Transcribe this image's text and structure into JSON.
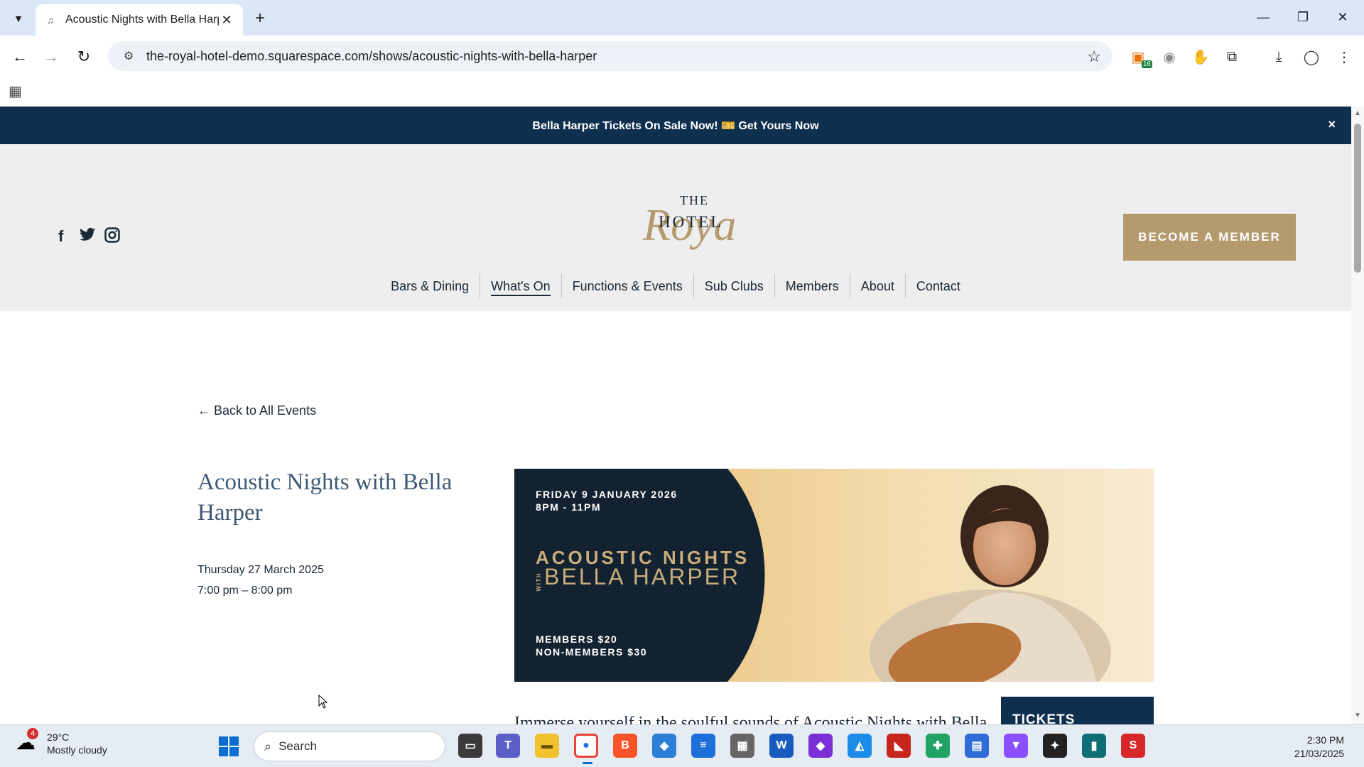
{
  "browser": {
    "tab_title": "Acoustic Nights with Bella Harp",
    "url": "the-royal-hotel-demo.squarespace.com/shows/acoustic-nights-with-bella-harper",
    "extension_badge": "16"
  },
  "announcement": {
    "text": "Bella Harper Tickets On Sale Now! 🎫 Get Yours Now",
    "close": "×"
  },
  "header": {
    "logo": {
      "the": "THE",
      "royal": "Royal",
      "hotel": "HOTEL"
    },
    "cta": "BECOME A MEMBER",
    "nav": [
      "Bars & Dining",
      "What's On",
      "Functions & Events",
      "Sub Clubs",
      "Members",
      "About",
      "Contact"
    ]
  },
  "event": {
    "back_link": "← Back to All Events",
    "title": "Acoustic Nights with Bella Harper",
    "date": "Thursday 27 March 2025",
    "time": "7:00 pm – 8:00 pm",
    "poster": {
      "date_line": "FRIDAY 9 JANUARY 2026",
      "time_line": "8PM - 11PM",
      "title_line": "ACOUSTIC NIGHTS",
      "with": "WITH",
      "artist": "BELLA HARPER",
      "members_price": "MEMBERS $20",
      "non_members_price": "NON-MEMBERS $30"
    },
    "description_start": "Immerse yourself in the soulful sounds of Acoustic Nights with Bella",
    "tickets_heading": "TICKETS"
  },
  "taskbar": {
    "weather_temp": "29°C",
    "weather_desc": "Mostly cloudy",
    "weather_badge": "4",
    "search_placeholder": "Search",
    "time": "2:30 PM",
    "date": "21/03/2025"
  },
  "colors": {
    "navy": "#0f2f4f",
    "gold": "#b49a6d",
    "header_bg": "#edeeed",
    "title_blue": "#3c5872"
  }
}
